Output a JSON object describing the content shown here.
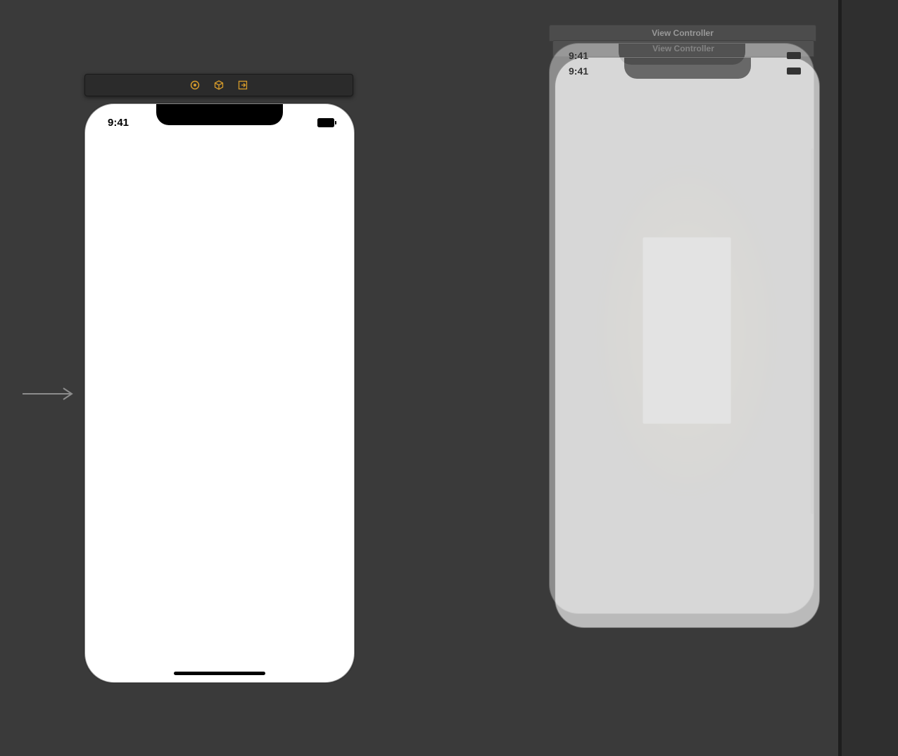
{
  "toolbar": {
    "icon1_name": "circle-dot-icon",
    "icon2_name": "cube-icon",
    "icon3_name": "exit-icon"
  },
  "status": {
    "time": "9:41"
  },
  "scenes": {
    "back_title": "View Controller",
    "front_title": "View Controller",
    "back_time": "9:41",
    "front_time": "9:41"
  }
}
